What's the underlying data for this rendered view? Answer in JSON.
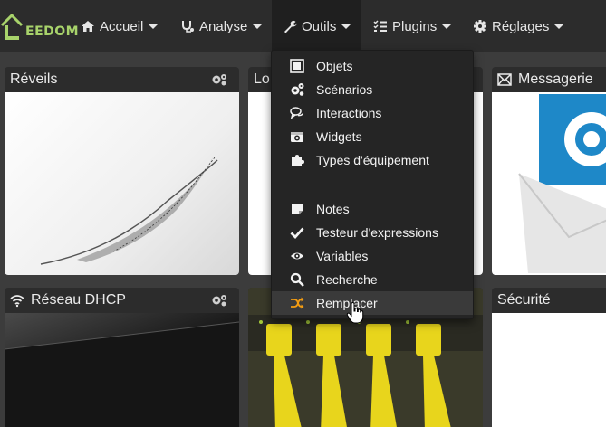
{
  "brand": {
    "text": "EEDOM",
    "color": "#a8d36b"
  },
  "nav": [
    {
      "label": "Accueil",
      "icon": "home-icon"
    },
    {
      "label": "Analyse",
      "icon": "stethoscope-icon"
    },
    {
      "label": "Outils",
      "icon": "wrench-icon"
    },
    {
      "label": "Plugins",
      "icon": "list-check-icon"
    },
    {
      "label": "Réglages",
      "icon": "cog-icon"
    }
  ],
  "tiles": {
    "reveils": {
      "title": "Réveils"
    },
    "loc": {
      "title": "Lo"
    },
    "messagerie": {
      "title": "Messagerie"
    },
    "dhcp": {
      "title": "Réseau DHCP"
    },
    "securite": {
      "title": "Sécurité"
    }
  },
  "outils_menu": {
    "group1": [
      {
        "label": "Objets",
        "icon": "object-icon"
      },
      {
        "label": "Scénarios",
        "icon": "cogs-icon"
      },
      {
        "label": "Interactions",
        "icon": "comments-icon"
      },
      {
        "label": "Widgets",
        "icon": "camera-icon"
      },
      {
        "label": "Types d'équipement",
        "icon": "puzzle-icon"
      }
    ],
    "group2": [
      {
        "label": "Notes",
        "icon": "sticky-note-icon"
      },
      {
        "label": "Testeur d'expressions",
        "icon": "check-icon"
      },
      {
        "label": "Variables",
        "icon": "eye-icon"
      },
      {
        "label": "Recherche",
        "icon": "search-icon"
      },
      {
        "label": "Remplacer",
        "icon": "shuffle-icon"
      }
    ]
  },
  "colors": {
    "navbar": "#2c2c2c",
    "dropdown": "#252525",
    "accent": "#f39c12",
    "mail_blue": "#1e88c8"
  }
}
